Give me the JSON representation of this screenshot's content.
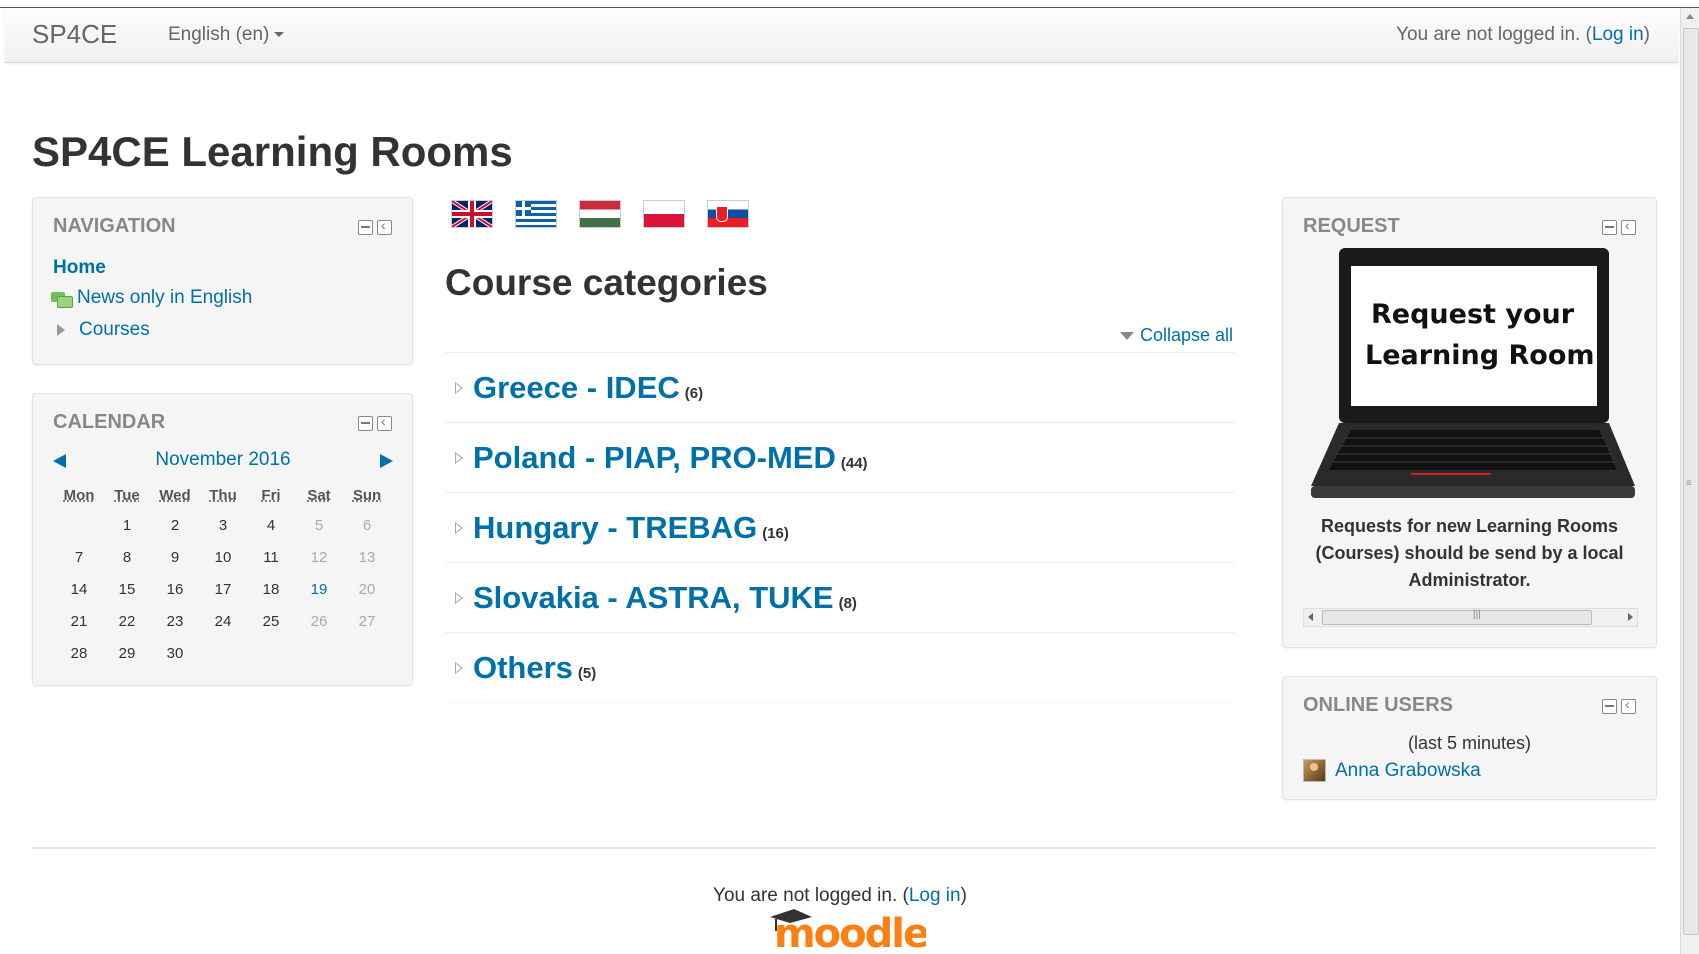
{
  "header": {
    "brand": "SP4CE",
    "language_menu": "English (en)",
    "login_prefix": "You are not logged in. (",
    "login_link": "Log in",
    "login_suffix": ")"
  },
  "page_title": "SP4CE Learning Rooms",
  "navigation": {
    "title": "NAVIGATION",
    "home": "Home",
    "news": "News only in English",
    "courses": "Courses"
  },
  "calendar": {
    "title": "CALENDAR",
    "month": "November 2016",
    "weekdays": [
      "Mon",
      "Tue",
      "Wed",
      "Thu",
      "Fri",
      "Sat",
      "Sun"
    ],
    "weeks": [
      [
        "",
        "1",
        "2",
        "3",
        "4",
        "5",
        "6"
      ],
      [
        "7",
        "8",
        "9",
        "10",
        "11",
        "12",
        "13"
      ],
      [
        "14",
        "15",
        "16",
        "17",
        "18",
        "19",
        "20"
      ],
      [
        "21",
        "22",
        "23",
        "24",
        "25",
        "26",
        "27"
      ],
      [
        "28",
        "29",
        "30",
        "",
        "",
        "",
        ""
      ]
    ],
    "today": "19"
  },
  "flags": [
    "uk-flag-icon",
    "greece-flag-icon",
    "hungary-flag-icon",
    "poland-flag-icon",
    "slovakia-flag-icon"
  ],
  "course_categories": {
    "title": "Course categories",
    "collapse_all": "Collapse all",
    "items": [
      {
        "name": "Greece - IDEC",
        "count": "(6)"
      },
      {
        "name": "Poland - PIAP, PRO-MED",
        "count": "(44)"
      },
      {
        "name": "Hungary - TREBAG",
        "count": "(16)"
      },
      {
        "name": "Slovakia - ASTRA, TUKE",
        "count": "(8)"
      },
      {
        "name": "Others",
        "count": "(5)"
      }
    ]
  },
  "request": {
    "title": "REQUEST",
    "image_line1": "Request your",
    "image_line2": "Learning Room",
    "text": "Requests for new Learning Rooms (Courses) should be send by a local Administrator."
  },
  "online_users": {
    "title": "ONLINE USERS",
    "subtitle": "(last 5 minutes)",
    "users": [
      "Anna Grabowska"
    ]
  },
  "footer": {
    "login_prefix": "You are not logged in. (",
    "login_link": "Log in",
    "login_suffix": ")",
    "logo_text": "moodle"
  },
  "colors": {
    "link": "#0070a8",
    "moodle_orange": "#f98012"
  }
}
